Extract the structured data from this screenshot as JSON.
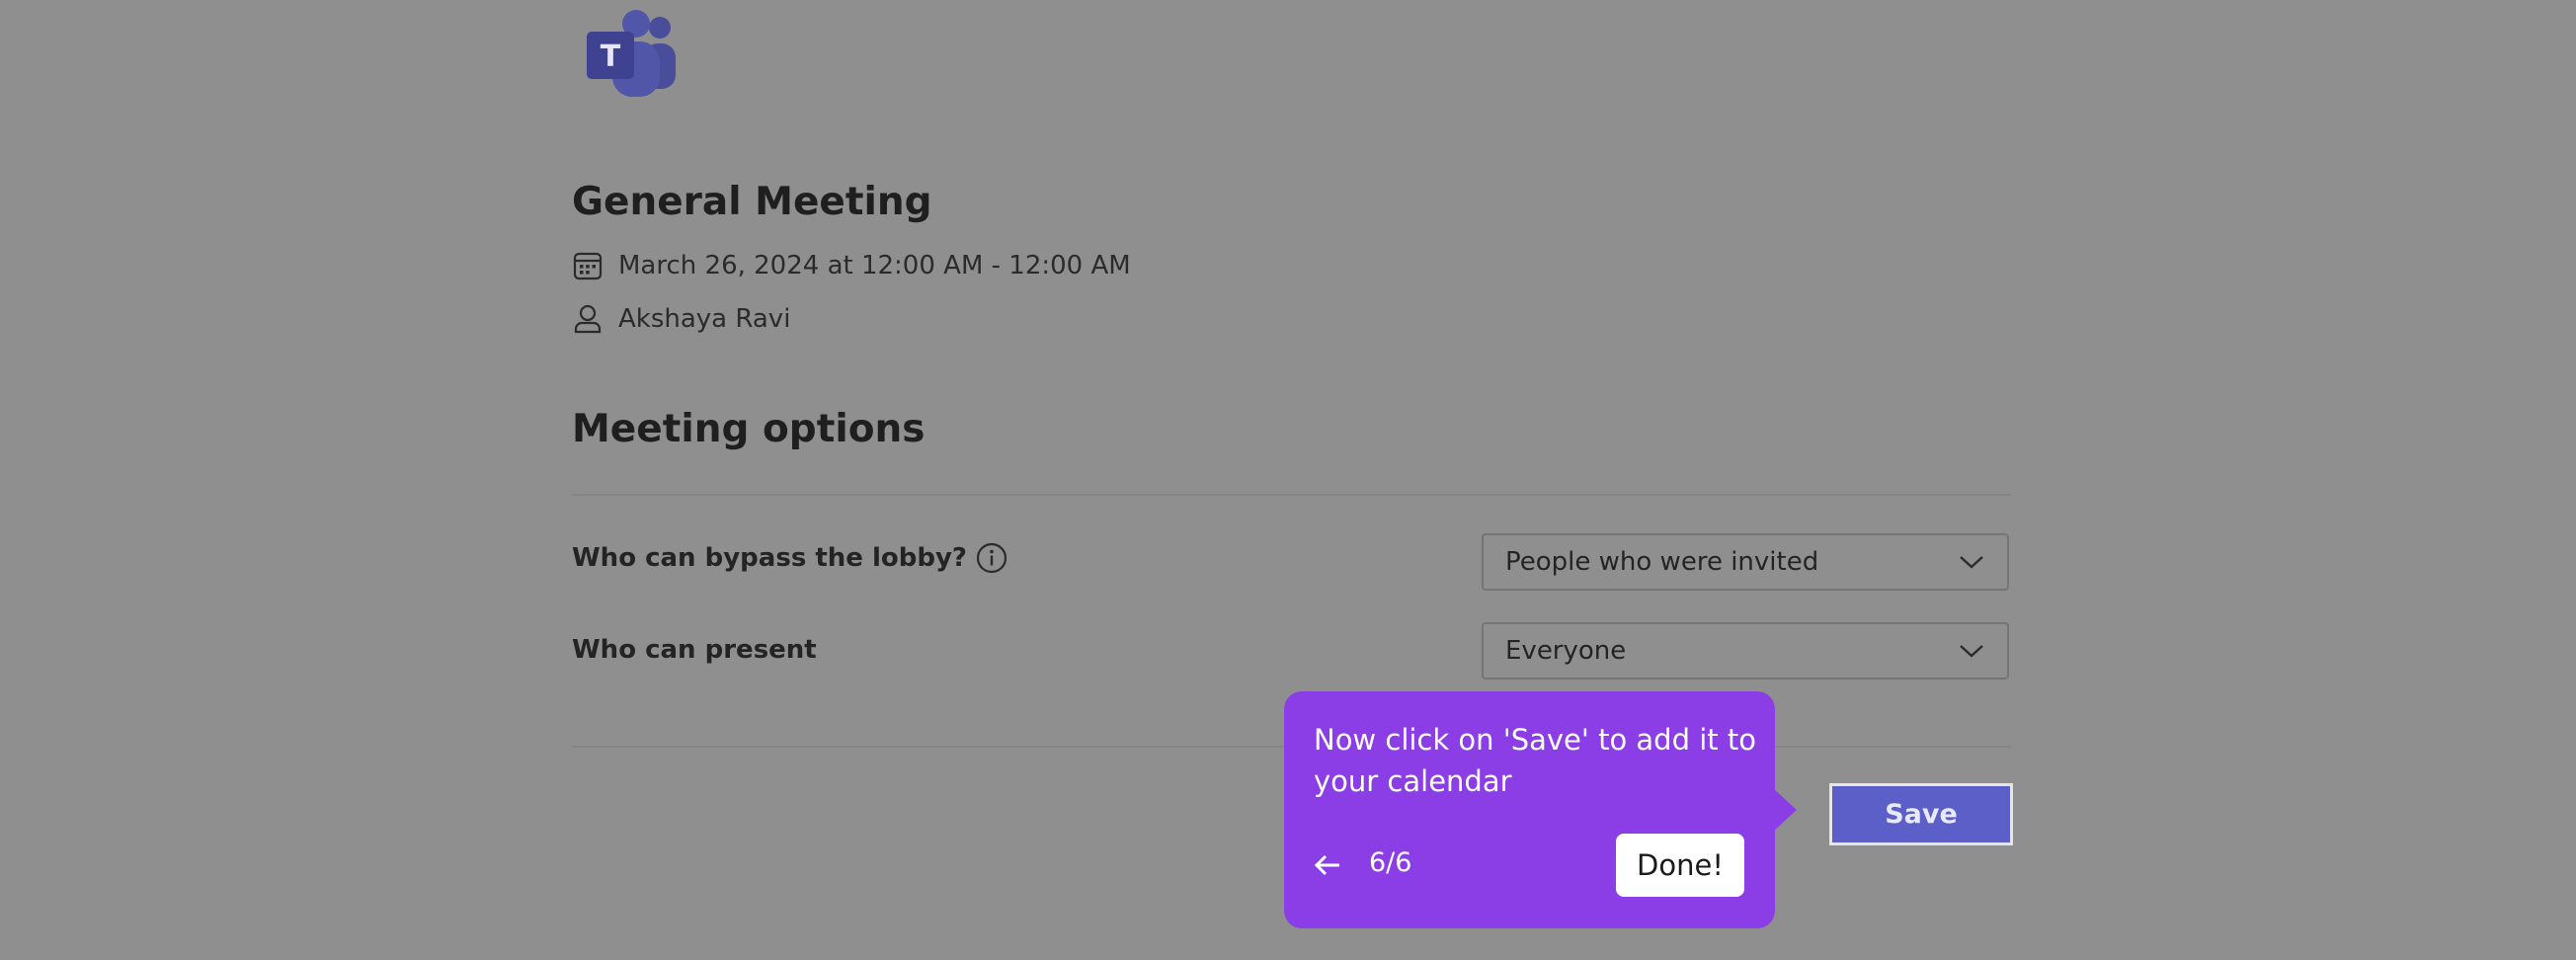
{
  "app": {
    "name": "Microsoft Teams",
    "logo_letter": "T"
  },
  "meeting": {
    "title": "General Meeting",
    "datetime": "March 26, 2024 at 12:00 AM - 12:00 AM",
    "organizer": "Akshaya Ravi"
  },
  "options": {
    "heading": "Meeting options",
    "items": [
      {
        "label": "Who can bypass the lobby?",
        "value": "People who were invited",
        "has_info": true
      },
      {
        "label": "Who can present",
        "value": "Everyone",
        "has_info": false
      }
    ]
  },
  "actions": {
    "save_label": "Save"
  },
  "tooltip": {
    "text": "Now click on 'Save' to add it to your calendar",
    "step": "6/6",
    "done_label": "Done!"
  },
  "colors": {
    "overlay": "#8f8f8f",
    "brand": "#5b5fc7",
    "tooltip": "#8c3ee6"
  }
}
